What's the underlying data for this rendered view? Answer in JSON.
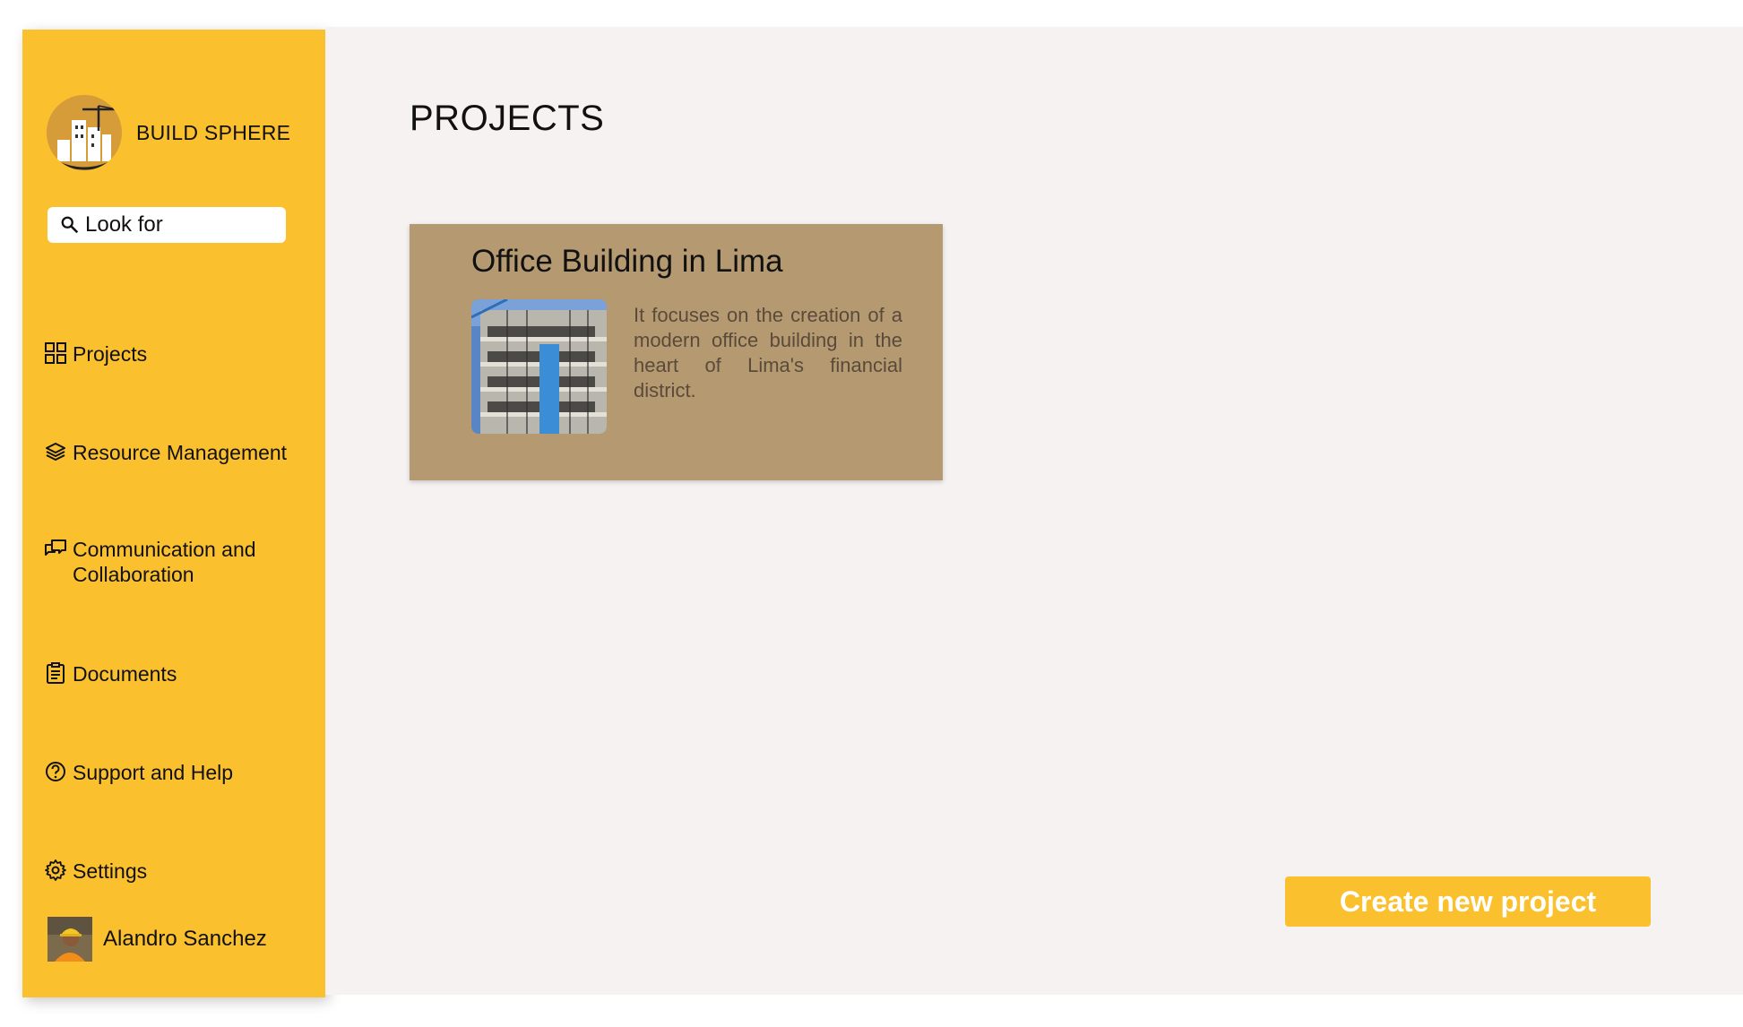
{
  "brand": {
    "name": "BUILD SPHERE",
    "logo_icon": "building-crane-logo"
  },
  "search": {
    "placeholder": "Look for",
    "icon": "search-icon"
  },
  "sidebar": {
    "items": [
      {
        "label": "Projects",
        "icon": "grid-icon"
      },
      {
        "label": "Resource Management",
        "icon": "layers-icon"
      },
      {
        "label": "Communication and Collaboration",
        "icon": "chat-icon"
      },
      {
        "label": "Documents",
        "icon": "clipboard-icon"
      },
      {
        "label": "Support and Help",
        "icon": "help-circle-icon"
      },
      {
        "label": "Settings",
        "icon": "gear-icon"
      }
    ]
  },
  "user": {
    "name": "Alandro Sanchez"
  },
  "main": {
    "title": "PROJECTS",
    "projects": [
      {
        "title": "Office Building in Lima",
        "description": "It focuses on the creation of a modern office building in the heart of Lima's financial district."
      }
    ],
    "create_button": "Create new project"
  },
  "colors": {
    "accent": "#fbc02d",
    "card": "#b59a71",
    "background": "#f6f2f1"
  }
}
